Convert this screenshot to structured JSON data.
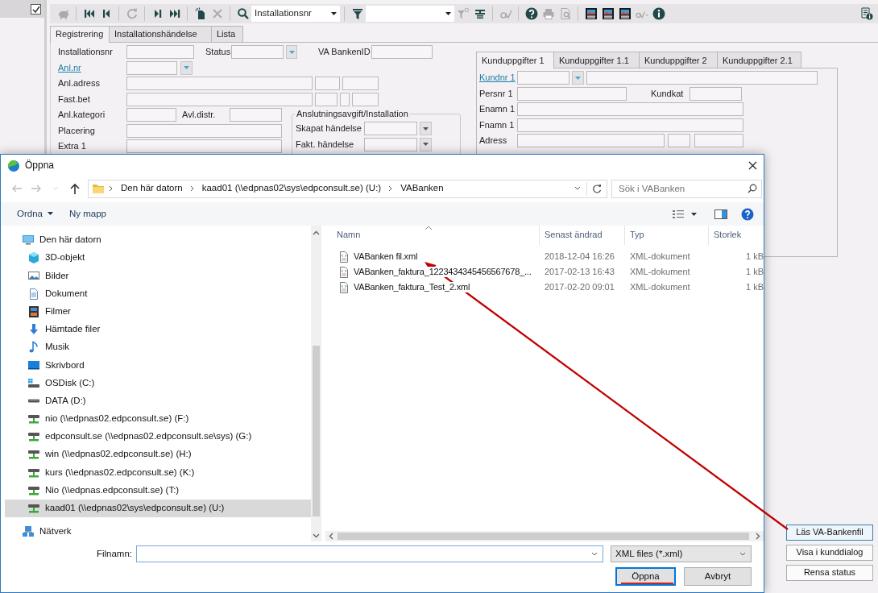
{
  "sidebar_checkbox": {
    "checked": true
  },
  "toolbar": [
    {
      "kind": "save",
      "disabled": true
    },
    {
      "kind": "separator"
    },
    {
      "kind": "first",
      "disabled": false
    },
    {
      "kind": "previous",
      "disabled": false
    },
    {
      "kind": "separator"
    },
    {
      "kind": "refresh",
      "disabled": true
    },
    {
      "kind": "separator"
    },
    {
      "kind": "next",
      "disabled": false
    },
    {
      "kind": "last",
      "disabled": false
    },
    {
      "kind": "separator"
    },
    {
      "kind": "new",
      "disabled": false
    },
    {
      "kind": "delete",
      "disabled": true
    },
    {
      "kind": "separator"
    },
    {
      "kind": "search",
      "disabled": false
    },
    {
      "kind": "combo",
      "value": "Installationsnr"
    },
    {
      "kind": "separator"
    },
    {
      "kind": "filter",
      "disabled": false
    },
    {
      "kind": "combo"
    },
    {
      "kind": "clear_filter",
      "disabled": true
    },
    {
      "kind": "form",
      "disabled": false
    },
    {
      "kind": "separator"
    },
    {
      "kind": "spellcheck",
      "disabled": true
    },
    {
      "kind": "separator"
    },
    {
      "kind": "help",
      "disabled": false
    },
    {
      "kind": "print",
      "disabled": true
    },
    {
      "kind": "preview",
      "disabled": true
    },
    {
      "kind": "separator"
    },
    {
      "kind": "image",
      "disabled": false
    },
    {
      "kind": "image",
      "disabled": false
    },
    {
      "kind": "image",
      "disabled": false
    },
    {
      "kind": "spellcheck_menu",
      "disabled": true
    },
    {
      "kind": "info",
      "disabled": false
    },
    {
      "kind": "spacer"
    },
    {
      "kind": "record_info",
      "disabled": false
    }
  ],
  "main_tabs": [
    {
      "label": "Registrering",
      "selected": true
    },
    {
      "label": "Installationshändelse",
      "selected": false
    },
    {
      "label": "Lista",
      "selected": false
    }
  ],
  "registration": {
    "rows": [
      [
        {
          "kind": "label",
          "text": "Installationsnr"
        },
        {
          "kind": "field"
        },
        {
          "kind": "label",
          "text": "Status"
        },
        {
          "kind": "field"
        },
        {
          "kind": "dropdown"
        },
        {
          "kind": "label",
          "text": "VA BankenID"
        },
        {
          "kind": "field"
        }
      ],
      [
        {
          "kind": "link",
          "text": "Anl.nr"
        },
        {
          "kind": "field"
        },
        {
          "kind": "dropdown"
        }
      ],
      [
        {
          "kind": "label",
          "text": "Anl.adress"
        },
        {
          "kind": "field"
        },
        {
          "kind": "field"
        },
        {
          "kind": "field"
        }
      ],
      [
        {
          "kind": "label",
          "text": "Fast.bet"
        },
        {
          "kind": "field"
        },
        {
          "kind": "field"
        },
        {
          "kind": "field"
        },
        {
          "kind": "field"
        }
      ],
      [
        {
          "kind": "label",
          "text": "Anl.kategori"
        },
        {
          "kind": "field"
        },
        {
          "kind": "label",
          "text": "Avl.distr."
        },
        {
          "kind": "field"
        }
      ],
      [
        {
          "kind": "label",
          "text": "Placering"
        },
        {
          "kind": "field"
        }
      ],
      [
        {
          "kind": "label",
          "text": "Extra 1"
        },
        {
          "kind": "field"
        }
      ]
    ],
    "group": {
      "title": "Anslutningsavgift/Installation",
      "rows": [
        [
          {
            "kind": "label",
            "text": "Skapat händelse"
          },
          {
            "kind": "field"
          },
          {
            "kind": "dropdown"
          }
        ],
        [
          {
            "kind": "label",
            "text": "Fakt. händelse"
          },
          {
            "kind": "field"
          },
          {
            "kind": "dropdown"
          }
        ]
      ]
    }
  },
  "customer_tabs": [
    {
      "label": "Kunduppgifter 1",
      "selected": true
    },
    {
      "label": "Kunduppgifter 1.1",
      "selected": false
    },
    {
      "label": "Kunduppgifter 2",
      "selected": false
    },
    {
      "label": "Kunduppgifter 2.1",
      "selected": false
    }
  ],
  "customer_rows": [
    [
      {
        "kind": "link",
        "text": "Kundnr 1"
      },
      {
        "kind": "field"
      },
      {
        "kind": "dropdown"
      },
      {
        "kind": "field"
      }
    ],
    [
      {
        "kind": "label",
        "text": "Persnr 1"
      },
      {
        "kind": "field"
      },
      {
        "kind": "label",
        "text": "Kundkat"
      },
      {
        "kind": "field"
      }
    ],
    [
      {
        "kind": "label",
        "text": "Enamn 1"
      },
      {
        "kind": "field"
      }
    ],
    [
      {
        "kind": "label",
        "text": "Fnamn 1"
      },
      {
        "kind": "field"
      }
    ],
    [
      {
        "kind": "label",
        "text": "Adress"
      },
      {
        "kind": "field"
      },
      {
        "kind": "field"
      },
      {
        "kind": "field"
      }
    ]
  ],
  "actions": [
    {
      "label": "Läs VA-Bankenfil",
      "focused": true
    },
    {
      "label": "Visa i kunddialog",
      "focused": false
    },
    {
      "label": "Rensa status",
      "focused": false
    }
  ],
  "dialog": {
    "title": "Öppna",
    "navigation": [
      {
        "kind": "back",
        "disabled": true
      },
      {
        "kind": "forward",
        "disabled": true
      },
      {
        "kind": "recent",
        "disabled": true
      },
      {
        "kind": "up",
        "disabled": false
      }
    ],
    "path": [
      "Den här datorn",
      "kaad01 (\\\\edpnas02\\sys\\edpconsult.se) (U:)",
      "VABanken"
    ],
    "search": {
      "placeholder": "Sök i VABanken"
    },
    "commands": [
      {
        "kind": "menu",
        "label": "Ordna"
      },
      {
        "kind": "button",
        "label": "Ny mapp"
      }
    ],
    "nav_tree": [
      {
        "label": "Den här datorn",
        "kind": "computer",
        "selected": false,
        "children": [
          {
            "label": "3D-objekt",
            "kind": "cube",
            "selected": false
          },
          {
            "label": "Bilder",
            "kind": "pictures",
            "selected": false
          },
          {
            "label": "Dokument",
            "kind": "documents",
            "selected": false
          },
          {
            "label": "Filmer",
            "kind": "videos",
            "selected": false
          },
          {
            "label": "Hämtade filer",
            "kind": "downloads",
            "selected": false
          },
          {
            "label": "Musik",
            "kind": "music",
            "selected": false
          },
          {
            "label": "Skrivbord",
            "kind": "desktop",
            "selected": false
          },
          {
            "label": "OSDisk (C:)",
            "kind": "osdisk",
            "selected": false
          },
          {
            "label": "DATA (D:)",
            "kind": "drive",
            "selected": false
          },
          {
            "label": "nio (\\\\edpnas02.edpconsult.se) (F:)",
            "kind": "netdrive",
            "selected": false
          },
          {
            "label": "edpconsult.se (\\\\edpnas02.edpconsult.se\\sys) (G:)",
            "kind": "netdrive",
            "selected": false
          },
          {
            "label": "win (\\\\edpnas02.edpconsult.se) (H:)",
            "kind": "netdrive",
            "selected": false
          },
          {
            "label": "kurs (\\\\edpnas02.edpconsult.se) (K:)",
            "kind": "netdrive",
            "selected": false
          },
          {
            "label": "Nio (\\\\edpnas.edpconsult.se) (T:)",
            "kind": "netdrive",
            "selected": false
          },
          {
            "label": "kaad01 (\\\\edpnas02\\sys\\edpconsult.se) (U:)",
            "kind": "netdrive",
            "selected": true
          }
        ]
      },
      {
        "label": "Nätverk",
        "kind": "network",
        "selected": false
      }
    ],
    "columns": [
      "Namn",
      "Senast ändrad",
      "Typ",
      "Storlek"
    ],
    "files": [
      {
        "name": "VABanken fil.xml",
        "modified": "2018-12-04 16:26",
        "type": "XML-dokument",
        "size": "1 kB"
      },
      {
        "name": "VABanken_faktura_1223434345456567678_...",
        "modified": "2017-02-13 16:43",
        "type": "XML-dokument",
        "size": "1 kB"
      },
      {
        "name": "VABanken_faktura_Test_2.xml",
        "modified": "2017-02-20 09:01",
        "type": "XML-dokument",
        "size": "1 kB"
      }
    ],
    "filename": {
      "label": "Filnamn:"
    },
    "filetype": {
      "value": "XML files (*.xml)"
    },
    "buttons": [
      {
        "label": "Öppna",
        "default": true
      },
      {
        "label": "Avbryt",
        "default": false
      }
    ]
  }
}
